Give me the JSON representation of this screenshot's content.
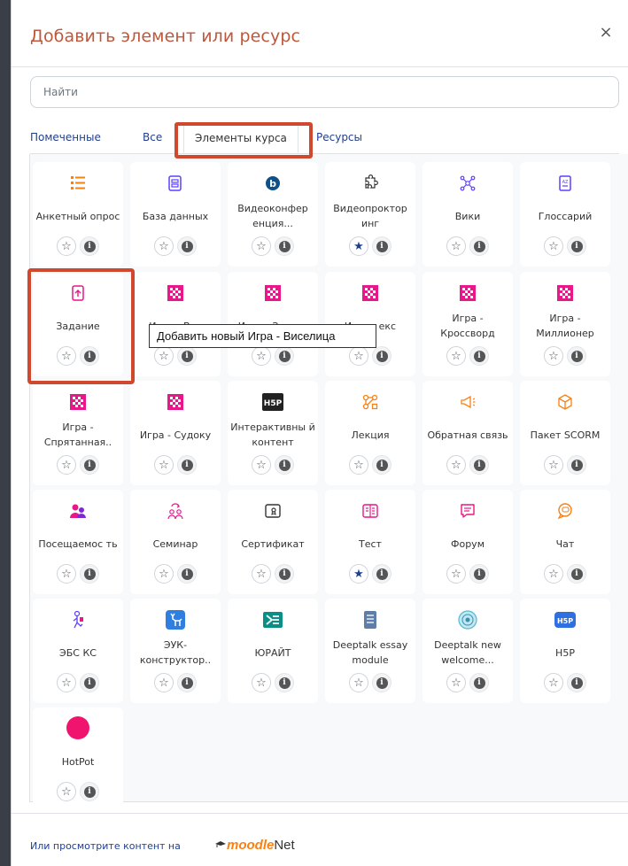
{
  "modal": {
    "title": "Добавить элемент или ресурс",
    "close_label": "×"
  },
  "search": {
    "placeholder": "Найти",
    "value": ""
  },
  "tabs": [
    {
      "label": "Помеченные",
      "active": false
    },
    {
      "label": "Все",
      "active": false
    },
    {
      "label": "Элементы курса",
      "active": true
    },
    {
      "label": "Ресурсы",
      "active": false
    }
  ],
  "items": [
    {
      "label": "Анкетный опрос",
      "icon": "survey-icon",
      "starred": false
    },
    {
      "label": "База данных",
      "icon": "database-icon",
      "starred": false
    },
    {
      "label": "Видеоконфер енция...",
      "icon": "bigbluebutton-icon",
      "starred": false
    },
    {
      "label": "Видеопроктор инг",
      "icon": "puzzle-icon",
      "starred": true
    },
    {
      "label": "Вики",
      "icon": "wiki-icon",
      "starred": false
    },
    {
      "label": "Глоссарий",
      "icon": "glossary-icon",
      "starred": false
    },
    {
      "label": "Задание",
      "icon": "assignment-upload-icon",
      "starred": false
    },
    {
      "label": "Игра - Вис",
      "icon": "game-grid-icon",
      "starred": false
    },
    {
      "label": "Игра - Змеи и",
      "icon": "game-grid-icon",
      "starred": false
    },
    {
      "label": "Игра - екс",
      "icon": "game-grid-icon",
      "starred": false
    },
    {
      "label": "Игра - Кроссворд",
      "icon": "game-grid-icon",
      "starred": false
    },
    {
      "label": "Игра - Миллионер",
      "icon": "game-grid-icon",
      "starred": false
    },
    {
      "label": "Игра - Спрятанная..",
      "icon": "game-grid-icon",
      "starred": false
    },
    {
      "label": "Игра - Судоку",
      "icon": "game-grid-icon",
      "starred": false
    },
    {
      "label": "Интерактивны й контент",
      "icon": "h5p-dark-icon",
      "starred": false
    },
    {
      "label": "Лекция",
      "icon": "lesson-icon",
      "starred": false
    },
    {
      "label": "Обратная связь",
      "icon": "feedback-megaphone-icon",
      "starred": false
    },
    {
      "label": "Пакет SCORM",
      "icon": "scorm-package-icon",
      "starred": false
    },
    {
      "label": "Посещаемос ть",
      "icon": "attendance-icon",
      "starred": false
    },
    {
      "label": "Семинар",
      "icon": "workshop-icon",
      "starred": false
    },
    {
      "label": "Сертификат",
      "icon": "certificate-icon",
      "starred": false
    },
    {
      "label": "Тест",
      "icon": "quiz-icon",
      "starred": true
    },
    {
      "label": "Форум",
      "icon": "forum-icon",
      "starred": false
    },
    {
      "label": "Чат",
      "icon": "chat-icon",
      "starred": false
    },
    {
      "label": "ЭБС КС",
      "icon": "ebs-icon",
      "starred": false
    },
    {
      "label": "ЭУК- конструктор..",
      "icon": "euk-deer-icon",
      "starred": false
    },
    {
      "label": "ЮРАЙТ",
      "icon": "urait-logo-icon",
      "starred": false
    },
    {
      "label": "Deeptalk essay module",
      "icon": "deeptalk-essay-icon",
      "starred": false
    },
    {
      "label": "Deeptalk new welcome...",
      "icon": "deeptalk-welcome-icon",
      "starred": false
    },
    {
      "label": "H5P",
      "icon": "h5p-blue-icon",
      "starred": false
    },
    {
      "label": "HotPot",
      "icon": "hotpot-dot-icon",
      "starred": false
    }
  ],
  "tooltip": {
    "text": "Добавить новый Игра - Виселица"
  },
  "footer": {
    "text": "Или просмотрите контент на",
    "moodle": "moodle",
    "net": "Net"
  },
  "colors": {
    "title": "#c0573a",
    "link": "#1f3f8f",
    "highlight": "#d0492e",
    "game": "#e8178a",
    "hotpot": "#f0146e"
  }
}
